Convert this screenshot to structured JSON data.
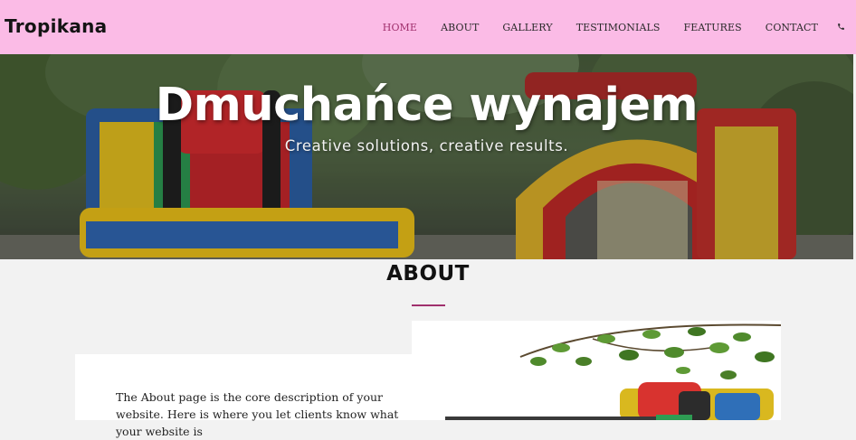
{
  "brand": {
    "name": "Tropikana"
  },
  "nav": {
    "items": [
      {
        "label": "HOME",
        "active": true
      },
      {
        "label": "ABOUT",
        "active": false
      },
      {
        "label": "GALLERY",
        "active": false
      },
      {
        "label": "TESTIMONIALS",
        "active": false
      },
      {
        "label": "FEATURES",
        "active": false
      },
      {
        "label": "CONTACT",
        "active": false
      }
    ],
    "phone_icon": "phone-icon"
  },
  "hero": {
    "title": "Dmuchańce wynajem",
    "subtitle": "Creative solutions, creative results."
  },
  "about": {
    "heading": "ABOUT",
    "paragraph": "The About page is the core description of your website. Here is where you let clients know what your website is"
  },
  "colors": {
    "navbar_bg": "#fbbbe6",
    "accent": "#a0306d",
    "page_bg": "#f2f2f2"
  }
}
